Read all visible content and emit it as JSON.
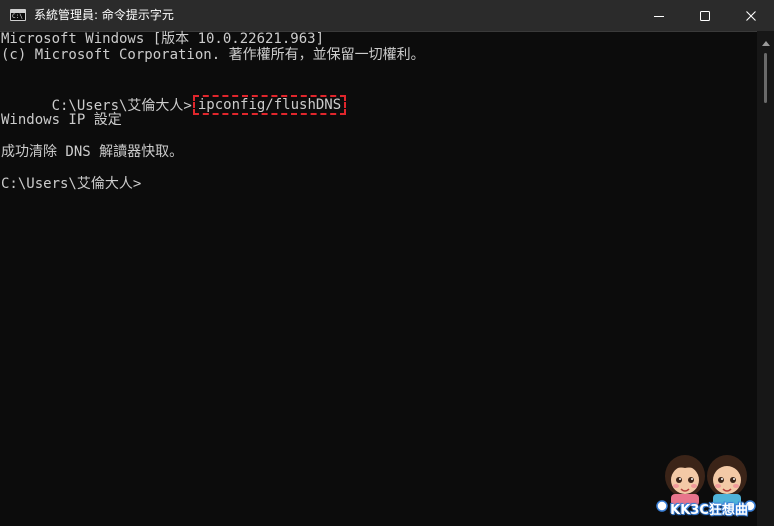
{
  "window": {
    "title": "系統管理員: 命令提示字元",
    "icon_text": "C:\\",
    "controls": {
      "minimize": "minimize-icon",
      "maximize": "maximize-icon",
      "close": "close-icon"
    }
  },
  "console": {
    "lines": [
      "Microsoft Windows [版本 10.0.22621.963]",
      "(c) Microsoft Corporation. 著作權所有，並保留一切權利。",
      "",
      "",
      "",
      "Windows IP 設定",
      "",
      "成功清除 DNS 解讀器快取。",
      "",
      "C:\\Users\\艾倫大人>"
    ],
    "prompt": "C:\\Users\\艾倫大人>",
    "command": "ipconfig/flushDNS"
  },
  "watermark": {
    "label": "KK3C狂想曲"
  },
  "colors": {
    "background": "#0c0c0c",
    "text": "#cccccc",
    "highlight": "#e0262c",
    "titlebar": "#2b2b2b"
  }
}
